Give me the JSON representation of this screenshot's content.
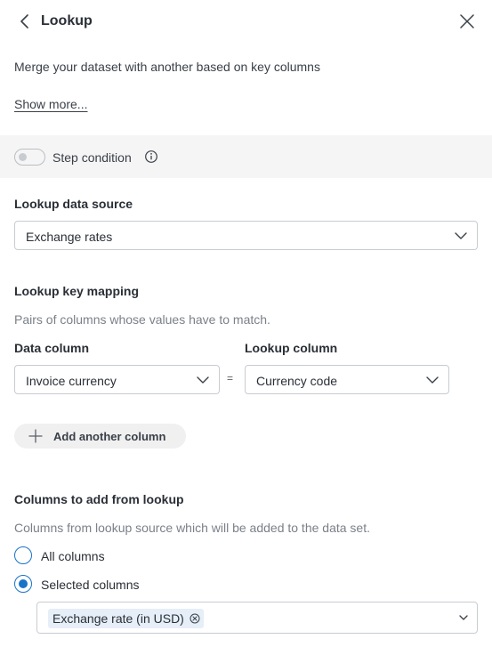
{
  "header": {
    "title": "Lookup",
    "back_icon": "chevron-left-icon",
    "close_icon": "close-icon"
  },
  "description": "Merge your dataset with another based on key columns",
  "show_more": "Show more...",
  "step_condition": {
    "label": "Step condition",
    "enabled": false,
    "info_icon": "info-icon"
  },
  "lookup_source": {
    "label": "Lookup data source",
    "value": "Exchange rates"
  },
  "key_mapping": {
    "label": "Lookup key mapping",
    "hint": "Pairs of columns whose values have to match.",
    "data_column_label": "Data column",
    "lookup_column_label": "Lookup column",
    "data_column_value": "Invoice currency",
    "equals": "=",
    "lookup_column_value": "Currency code",
    "add_button": "Add another column"
  },
  "columns_to_add": {
    "label": "Columns to add from lookup",
    "hint": "Columns from lookup source which will be added to the data set.",
    "options": [
      {
        "label": "All columns",
        "selected": false
      },
      {
        "label": "Selected columns",
        "selected": true
      }
    ],
    "selected_chips": [
      "Exchange rate (in USD)"
    ]
  },
  "colors": {
    "accent": "#1a73c8",
    "band": "#f5f5f5",
    "chip": "#e6eef8",
    "text": "#2a2f36",
    "hint": "#7b8089"
  }
}
